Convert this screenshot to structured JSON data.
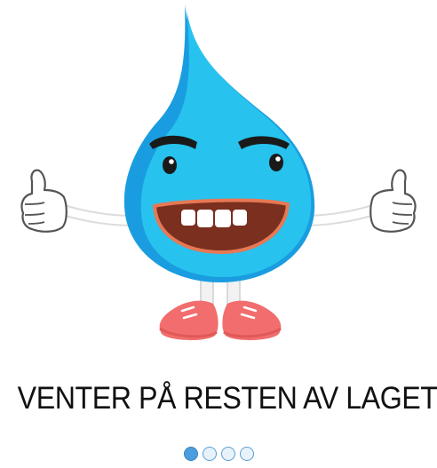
{
  "status": {
    "message": "VENTER PÅ RESTEN AV LAGET"
  },
  "mascot": {
    "icon": "water-drop-mascot-thumbs-up-icon",
    "colors": {
      "drop_light": "#27c3ee",
      "drop_dark": "#1a9de0",
      "glove": "#ffffff",
      "shoe": "#f26d6d",
      "mouth": "#7a2f1f"
    }
  },
  "pagination": {
    "total": 4,
    "active_index": 0,
    "colors": {
      "active": "#4a9ee0",
      "inactive": "#e8f2fb",
      "border": "#5b9ed0"
    }
  }
}
